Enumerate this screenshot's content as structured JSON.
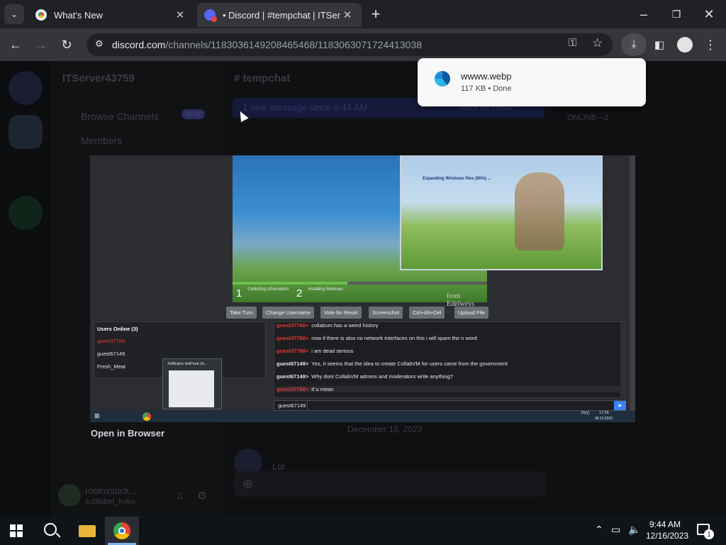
{
  "browser": {
    "tabs": [
      {
        "title": "What's New",
        "active": false
      },
      {
        "title": "• Discord | #tempchat | ITServer",
        "active": true
      }
    ],
    "url_host": "discord.com",
    "url_path": "/channels/1183036149208465468/1183063071724413038"
  },
  "download": {
    "filename": "wwww.webp",
    "status": "117 KB • Done"
  },
  "discord": {
    "server_name": "ITServer43759",
    "channel_name": "tempchat",
    "browse_channels": "Browse Channels",
    "members": "Members",
    "new_badge": "NEW",
    "new_messages_bar": "1 new message since 9:44 AM",
    "mark_read": "Mark As Read",
    "member_section": "ONLINE—2",
    "date_divider": "December 16, 2023",
    "last_message": "Lol",
    "user_name": "robloxsuck...",
    "user_status": "sublabel_kuku"
  },
  "viewer": {
    "open_in_browser": "Open in Browser",
    "vm": {
      "steps": [
        {
          "num": "1",
          "label": "Collecting information"
        },
        {
          "num": "2",
          "label": "Installing Windows"
        }
      ],
      "setup_lines": [
        "Expanding Windows files (90%) ..."
      ],
      "credit": "from Edelweys",
      "progress": 0.45,
      "buttons": [
        "Take Turn",
        "Change Username",
        "Vote for Reset",
        "Screenshot",
        "Ctrl+Alt+Del",
        "Upload File"
      ],
      "users_header": "Users Online (3)",
      "users": [
        {
          "name": "guest37768",
          "color": "#e53935"
        },
        {
          "name": "guest67149",
          "color": "#e4e4e4"
        },
        {
          "name": "Fresh_Meat",
          "color": "#e4e4e4"
        }
      ],
      "messages": [
        {
          "nick": "guest37768>",
          "text": "collabvm has a weird history",
          "nick_color": "#e53935"
        },
        {
          "nick": "guest37768>",
          "text": "now if there is also no network interfaces on this i will spam the n word",
          "nick_color": "#e53935"
        },
        {
          "nick": "guest37768>",
          "text": "i am dead serious",
          "nick_color": "#e53935"
        },
        {
          "nick": "guest67149>",
          "text": "Yes, it seems that the idea to create CollabVM for users came from the government",
          "nick_color": "#ffffff"
        },
        {
          "nick": "guest67149>",
          "text": "Why dont CollabVM admins and moderators write anything?",
          "nick_color": "#ffffff"
        },
        {
          "nick": "guest37768>",
          "text": "tf u mean",
          "nick_color": "#e53935"
        }
      ],
      "input_nick": "guest67149",
      "thumb_title": "JetBrains dotPeek (A...",
      "vm_clock": "17:26",
      "vm_date": "08.12.2023",
      "vm_lang": "РУС"
    }
  },
  "taskbar": {
    "time": "9:44 AM",
    "date": "12/16/2023",
    "notifications": "1"
  }
}
